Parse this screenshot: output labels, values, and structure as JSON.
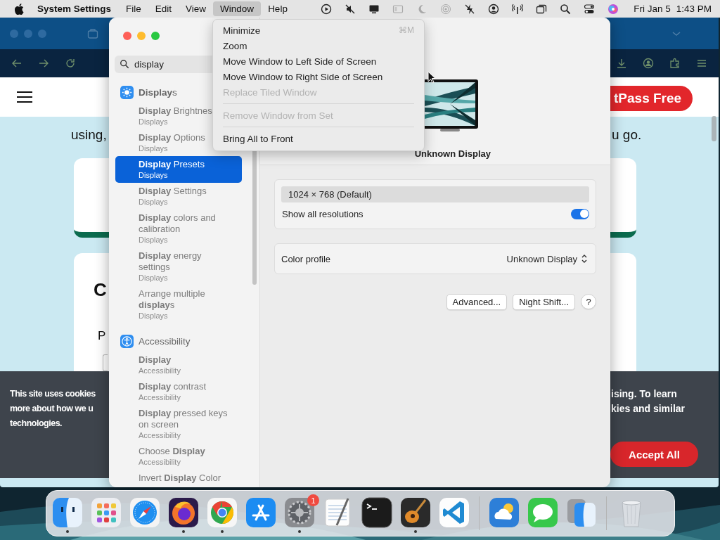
{
  "menu_bar": {
    "app_name": "System Settings",
    "menus": [
      {
        "label": "File",
        "selected": false
      },
      {
        "label": "Edit",
        "selected": false
      },
      {
        "label": "View",
        "selected": false
      },
      {
        "label": "Window",
        "selected": true
      },
      {
        "label": "Help",
        "selected": false
      }
    ],
    "status_icons": [
      {
        "kind": "play",
        "dimmed": false
      },
      {
        "kind": "mute",
        "dimmed": false
      },
      {
        "kind": "monitor",
        "dimmed": false
      },
      {
        "kind": "sidebar",
        "dimmed": true
      },
      {
        "kind": "moon",
        "dimmed": true
      },
      {
        "kind": "broadcast",
        "dimmed": true
      },
      {
        "kind": "bolt",
        "dimmed": false
      },
      {
        "kind": "user",
        "dimmed": false
      },
      {
        "kind": "antenna",
        "dimmed": false
      },
      {
        "kind": "windows",
        "dimmed": false
      },
      {
        "kind": "search",
        "dimmed": false
      },
      {
        "kind": "toggles",
        "dimmed": false
      },
      {
        "kind": "orb",
        "dimmed": false
      }
    ],
    "date": "Fri Jan 5",
    "time": "1:43 PM"
  },
  "browser": {
    "header_button": "tPass Free",
    "intro_left": "using,",
    "intro_right": "u go.",
    "card_letters": [
      "C",
      "P"
    ],
    "cookie_left": [
      "This site uses cookies",
      "more about how we u",
      "technologies."
    ],
    "cookie_right": [
      "ising. To learn",
      "kies and similar"
    ],
    "accept_button": "Accept All"
  },
  "settings": {
    "search": {
      "value": "display"
    },
    "groups": [
      {
        "kind": "displays",
        "title": "**Display**s",
        "items": [
          {
            "title": "**Display** Brightnes",
            "subtitle": "Displays",
            "selected": false
          },
          {
            "title": "**Display** Options",
            "subtitle": "Displays",
            "selected": false
          },
          {
            "title": "**Display** Presets",
            "subtitle": "Displays",
            "selected": true
          },
          {
            "title": "**Display** Settings",
            "subtitle": "Displays",
            "selected": false
          },
          {
            "title": "**Display** colors and calibration",
            "subtitle": "Displays",
            "selected": false
          },
          {
            "title": "**Display** energy settings",
            "subtitle": "Displays",
            "selected": false
          },
          {
            "title": "Arrange multiple **display**s",
            "subtitle": "Displays",
            "selected": false
          }
        ]
      },
      {
        "kind": "accessibility",
        "title": "Accessibility",
        "items": [
          {
            "title": "**Display**",
            "subtitle": "Accessibility",
            "selected": false
          },
          {
            "title": "**Display** contrast",
            "subtitle": "Accessibility",
            "selected": false
          },
          {
            "title": "**Display** pressed keys on screen",
            "subtitle": "Accessibility",
            "selected": false
          },
          {
            "title": "Choose **Display**",
            "subtitle": "Accessibility",
            "selected": false
          },
          {
            "title": "Invert **Display** Color",
            "selected": false
          }
        ]
      }
    ],
    "display_name": "Unknown Display",
    "resolution": {
      "value": "1024 × 768 (Default)",
      "selected": true
    },
    "show_all": {
      "label": "Show all resolutions",
      "on": true
    },
    "color_profile": {
      "label": "Color profile",
      "value": "Unknown Display"
    },
    "buttons": [
      "Advanced...",
      "Night Shift...",
      "?"
    ]
  },
  "window_menu": [
    {
      "kind": "item",
      "label": "Minimize",
      "shortcut": "⌘M",
      "disabled": false
    },
    {
      "kind": "item",
      "label": "Zoom",
      "disabled": false
    },
    {
      "kind": "item",
      "label": "Move Window to Left Side of Screen",
      "disabled": false
    },
    {
      "kind": "item",
      "label": "Move Window to Right Side of Screen",
      "disabled": false
    },
    {
      "kind": "item",
      "label": "Replace Tiled Window",
      "disabled": true
    },
    {
      "kind": "separator"
    },
    {
      "kind": "item",
      "label": "Remove Window from Set",
      "disabled": true
    },
    {
      "kind": "separator"
    },
    {
      "kind": "item",
      "label": "Bring All to Front",
      "disabled": false
    }
  ],
  "dock": [
    {
      "kind": "finder",
      "running": true
    },
    {
      "kind": "launchpad",
      "running": false
    },
    {
      "kind": "safari",
      "running": false
    },
    {
      "kind": "firefox",
      "running": true
    },
    {
      "kind": "chrome",
      "running": true
    },
    {
      "kind": "appstore",
      "running": false
    },
    {
      "kind": "settings",
      "running": true,
      "badge": "1"
    },
    {
      "kind": "textedit",
      "running": false
    },
    {
      "kind": "terminal",
      "running": false
    },
    {
      "kind": "garageband",
      "running": true
    },
    {
      "kind": "vscode",
      "running": false
    },
    {
      "kind": "separator"
    },
    {
      "kind": "weather",
      "running": false
    },
    {
      "kind": "messages",
      "running": false
    },
    {
      "kind": "finder2",
      "running": false
    },
    {
      "kind": "separator"
    },
    {
      "kind": "trash",
      "running": false
    }
  ]
}
